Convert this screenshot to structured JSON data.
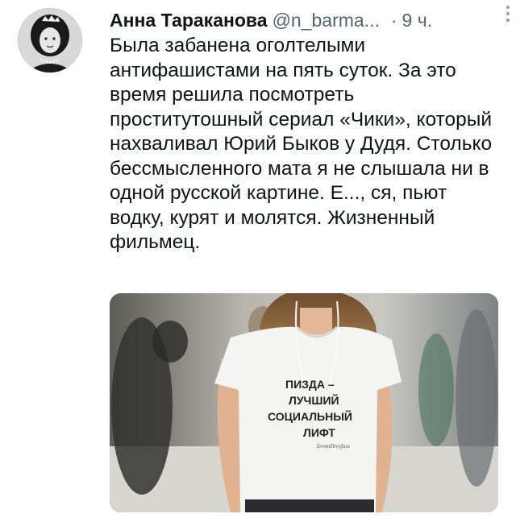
{
  "tweet": {
    "author_name": "Анна Тараканова",
    "handle": "@n_barma...",
    "separator": "·",
    "time": "9 ч.",
    "text": "Была забанена оголтелыми антифашистами на пять суток. За это время решила посмотреть проститутошный сериал «Чики», который нахваливал Юрий Быков у Дудя. Столько бессмысленного мата я не слышала ни в одной русской картине. Е..., ся, пьют водку, курят и молятся. Жизненный фильмец."
  },
  "photo": {
    "shirt_print_lines": [
      "ПИЗДА –",
      "ЛУЧШИЙ",
      "СОЦИАЛЬНЫЙ",
      "ЛИФТ"
    ],
    "shirt_signature": "JeromDreyfuss"
  },
  "icons": {
    "more": "more-vertical-icon"
  }
}
